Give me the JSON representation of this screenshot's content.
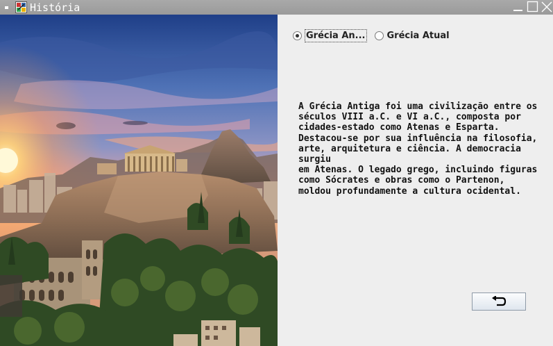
{
  "window": {
    "title": "História"
  },
  "options": {
    "ancient_label": "Grécia An...",
    "modern_label": "Grécia Atual",
    "selected": "ancient"
  },
  "content": {
    "description": "A Grécia Antiga foi uma civilização entre os\nséculos VIII a.C. e VI a.C., composta por\ncidades-estado como Atenas e Esparta.\nDestacou-se por sua influência na filosofia,\narte, arquitetura e ciência. A democracia surgiu\nem Atenas. O legado grego, incluindo figuras\ncomo Sócrates e obras como o Partenon,\nmoldou profundamente a cultura ocidental."
  },
  "icons": {
    "app": "java-app-icon",
    "back": "undo-arrow-icon",
    "minimize": "minimize-icon",
    "maximize": "maximize-icon",
    "close": "close-icon"
  },
  "colors": {
    "titlebar": "#a3a3a3",
    "panel": "#eeeeee",
    "text": "#111111"
  }
}
